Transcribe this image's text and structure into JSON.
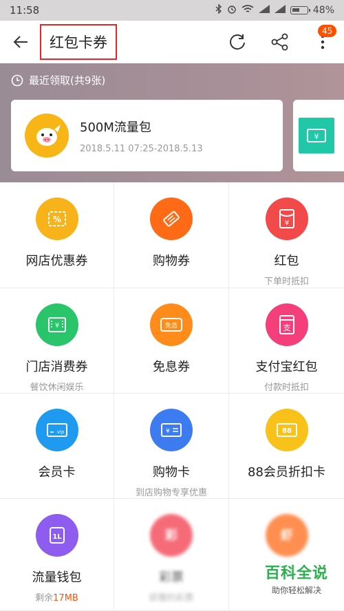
{
  "status_bar": {
    "time": "11:58",
    "battery": "48%"
  },
  "header": {
    "title": "红包卡券",
    "badge_count": "45"
  },
  "recent": {
    "title": "最近领取(共9张)",
    "card": {
      "name": "500M流量包",
      "date": "2018.5.11 07:25-2018.5.13"
    }
  },
  "grid": [
    {
      "label": "网店优惠券",
      "sub": "",
      "color": "#f8b31b",
      "glyph": "%"
    },
    {
      "label": "购物券",
      "sub": "",
      "color": "#ff6a16",
      "glyph": ""
    },
    {
      "label": "红包",
      "sub": "下单时抵扣",
      "color": "#f24a4a",
      "glyph": "¥"
    },
    {
      "label": "门店消费券",
      "sub": "餐饮休闲娱乐",
      "color": "#2ac46b",
      "glyph": "¥"
    },
    {
      "label": "免息券",
      "sub": "",
      "color": "#ff8c1a",
      "glyph": "免息"
    },
    {
      "label": "支付宝红包",
      "sub": "付款时抵扣",
      "color": "#f43f7a",
      "glyph": "支"
    },
    {
      "label": "会员卡",
      "sub": "",
      "color": "#1e9af0",
      "glyph": "vip"
    },
    {
      "label": "购物卡",
      "sub": "到店购物专享优惠",
      "color": "#3d7cf0",
      "glyph": "¥"
    },
    {
      "label": "88会员折扣卡",
      "sub": "",
      "color": "#f8c21b",
      "glyph": "88"
    },
    {
      "label": "流量钱包",
      "sub_prefix": "剩余",
      "sub_highlight": "17MB",
      "color": "#8f5cf0",
      "glyph": "1L"
    },
    {
      "label": "彩票",
      "sub": "获赠的彩票",
      "color": "#f23c4c",
      "glyph": "彩"
    },
    {
      "label": "",
      "sub": "",
      "color": "#ff6a16",
      "glyph": "虾"
    }
  ],
  "watermark": {
    "title": "百科全说",
    "sub": "助你轻松解决"
  }
}
